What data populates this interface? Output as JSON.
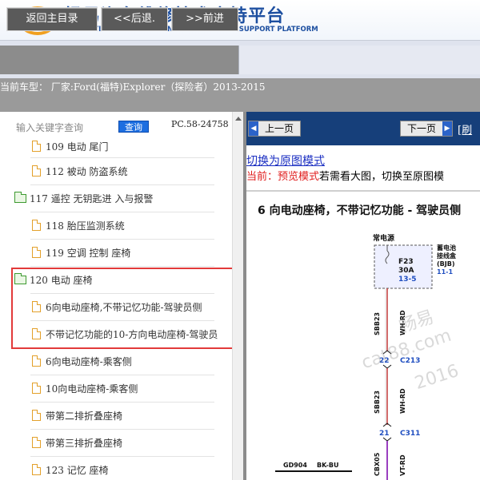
{
  "header": {
    "title_cn": "畅易汽车维修技术支持平台",
    "title_en": "CHANG YI AUTO MAINTENANCE TECHNOLOGY SUPPORT PLATFORM",
    "logo_icon": "chang-yi-logo"
  },
  "toolbar": {
    "home_label": "返回主目录",
    "back_label": "<<后退.",
    "forward_label": ">>前进"
  },
  "model_bar": {
    "text": "当前车型：  厂家:Ford(福特)Explorer（探险者）2013-2015"
  },
  "search": {
    "placeholder": "输入关键字查询",
    "button_label": "查询",
    "pc_code": "PC.58-24758"
  },
  "tree": {
    "items": [
      {
        "label": "109 电动 尾门",
        "type": "file"
      },
      {
        "label": "112 被动 防盗系统",
        "type": "file"
      },
      {
        "label": "117 遥控 无钥匙进 入与报警",
        "type": "folder"
      },
      {
        "label": "118 胎压监测系统",
        "type": "file"
      },
      {
        "label": "119 空调 控制 座椅",
        "type": "file"
      },
      {
        "label": "120 电动 座椅",
        "type": "folder"
      },
      {
        "label": "6向电动座椅,不带记忆功能-驾驶员侧",
        "type": "file"
      },
      {
        "label": "不带记忆功能的10-方向电动座椅-驾驶员",
        "type": "file"
      },
      {
        "label": "6向电动座椅-乘客侧",
        "type": "file"
      },
      {
        "label": "10向电动座椅-乘客侧",
        "type": "file"
      },
      {
        "label": "带第二排折叠座椅",
        "type": "file"
      },
      {
        "label": "带第三排折叠座椅",
        "type": "file"
      },
      {
        "label": "123 记忆 座椅",
        "type": "file"
      }
    ]
  },
  "viewer": {
    "prev_label": "上一页",
    "next_label": "下一页",
    "more_label": "[刷",
    "switch_link": "切换为原图模式",
    "preview_prefix": "当前：预览模式",
    "preview_suffix": "若需看大图，切换至原图模",
    "diagram_title": "6 向电动座椅，不带记忆功能 - 驾驶员侧",
    "diagram": {
      "always_power": "常电源",
      "fuse_id": "F23",
      "fuse_rating": "30A",
      "fuse_ref": "13-5",
      "box_label_1": "蓄电池",
      "box_label_2": "接线盒",
      "box_label_3": "(BJB)",
      "box_ref": "11-1",
      "wire_1": "SBB23",
      "color_1": "WH-RD",
      "pin_1": "22",
      "conn_1": "C213",
      "wire_2": "SBB23",
      "color_2": "WH-RD",
      "pin_2": "21",
      "conn_2": "C311",
      "wire_3": "CBX05",
      "color_3": "VT-RD",
      "ground": "GD904",
      "ground_color": "BK-BU"
    },
    "watermarks": [
      "畅易",
      "cat88.com",
      "2016"
    ]
  },
  "colors": {
    "brand_blue": "#1d4fa0",
    "nav_bar": "#163f7a",
    "highlight_red": "#e23a3a",
    "preview_red": "#e01c1c"
  }
}
